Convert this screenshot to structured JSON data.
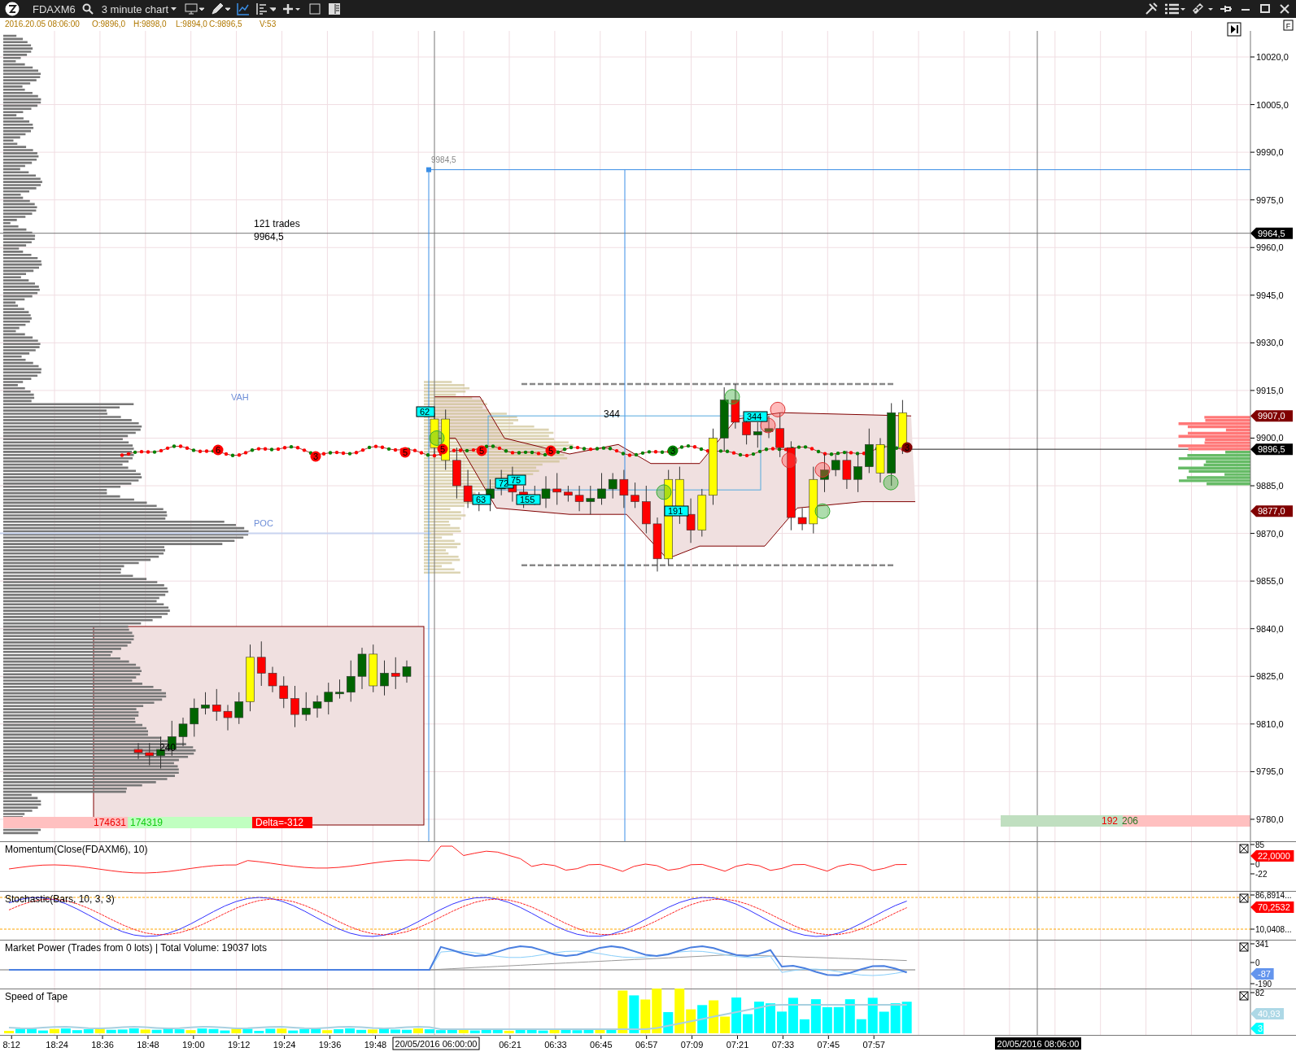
{
  "toolbar": {
    "symbol": "FDAXM6",
    "timeframe": "3 minute chart"
  },
  "info_bar": [
    "2016.20.05 08:06:00",
    "O:9896,0",
    "H:9898,0",
    "L:9894,0",
    "C:9896,5",
    "V:53"
  ],
  "panel_button": "F",
  "price_axis": [
    "10020,0",
    "10005,0",
    "9990,0",
    "9975,0",
    "9960,0",
    "9945,0",
    "9930,0",
    "9915,0",
    "9900,0",
    "9885,0",
    "9870,0",
    "9855,0",
    "9840,0",
    "9825,0",
    "9810,0",
    "9795,0",
    "9780,0"
  ],
  "price_markers": [
    {
      "value": "9964,5",
      "color": "#000000"
    },
    {
      "value": "9907,0",
      "color": "#800000"
    },
    {
      "value": "9896,5",
      "color": "#000000"
    },
    {
      "value": "9877,0",
      "color": "#800000"
    }
  ],
  "chart_labels": [
    {
      "kind": "level",
      "text": "9984,5"
    },
    {
      "kind": "note",
      "text": "121 trades"
    },
    {
      "kind": "note",
      "text": "9964,5"
    },
    {
      "kind": "note",
      "text": "344"
    },
    {
      "kind": "zone",
      "text": "VAH"
    },
    {
      "kind": "zone",
      "text": "POC"
    },
    {
      "kind": "note",
      "text": "240"
    }
  ],
  "cluster_labels": [
    "62",
    "72",
    "75",
    "63",
    "155",
    "191",
    "344"
  ],
  "count_markers": [
    {
      "text": "6",
      "color": "#ff0000"
    },
    {
      "text": "3",
      "color": "#ff0000"
    },
    {
      "text": "5",
      "color": "#ff0000"
    },
    {
      "text": "5",
      "color": "#ff0000"
    },
    {
      "text": "5",
      "color": "#ff0000"
    },
    {
      "text": "5",
      "color": "#ff0000"
    },
    {
      "text": "3",
      "color": "#008000"
    },
    {
      "text": "3",
      "color": "#800000"
    }
  ],
  "volume_summary": {
    "sell": "174631",
    "buy": "174319",
    "delta": "Delta=-312",
    "right_sell": "192",
    "right_buy": "206"
  },
  "indicators": [
    {
      "kind": "momentum",
      "title": "Momentum(Close(FDAXM6), 10)",
      "scale": [
        "85",
        "0",
        "-22"
      ],
      "markers": [
        {
          "value": "22,0000",
          "color": "#ff0000"
        }
      ]
    },
    {
      "kind": "stochastic",
      "title": "Stochastic(Bars, 10, 3, 3)",
      "scale": [
        "86,8914...",
        "10,0408..."
      ],
      "markers": [
        {
          "value": "70,2532",
          "color": "#ff0000"
        }
      ]
    },
    {
      "kind": "power",
      "title": "Market Power (Trades from 0 lots) | Total Volume: 19037 lots",
      "scale": [
        "341",
        "0",
        "-190"
      ],
      "markers": [
        {
          "value": "-87",
          "color": "#6495ed"
        }
      ]
    },
    {
      "kind": "tape",
      "title": "Speed of Tape",
      "scale": [
        "82"
      ],
      "markers": [
        {
          "value": "40,93",
          "color": "#add8e6"
        },
        {
          "value": "3",
          "color": "#00ffff"
        }
      ]
    }
  ],
  "time_axis": {
    "labels": [
      "8:12",
      "18:24",
      "18:36",
      "18:48",
      "19:00",
      "19:12",
      "19:24",
      "19:36",
      "19:48",
      "06:21",
      "06:33",
      "06:45",
      "06:57",
      "07:09",
      "07:21",
      "07:33",
      "07:45",
      "07:57"
    ],
    "session_label": "20/05/2016 06:00:00",
    "cursor_label": "20/05/2016 08:06:00"
  }
}
